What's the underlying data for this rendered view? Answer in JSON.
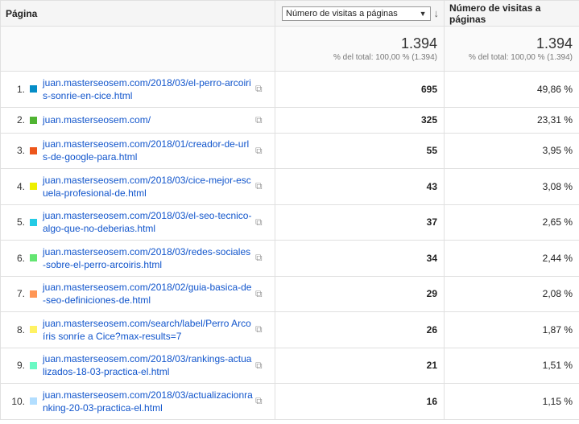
{
  "header": {
    "col_page": "Página",
    "metric_select": "Número de visitas a páginas",
    "col_pct": "Número de visitas a páginas"
  },
  "totals": {
    "value": "1.394",
    "sub": "% del total: 100,00 % (1.394)",
    "value2": "1.394",
    "sub2": "% del total: 100,00 % (1.394)"
  },
  "colors": [
    "#058dc7",
    "#50b432",
    "#ed561b",
    "#edef00",
    "#24cbe5",
    "#64e572",
    "#ff9655",
    "#fff263",
    "#6af9c4",
    "#b2deff"
  ],
  "rows": [
    {
      "num": "1.",
      "page": "juan.masterseosem.com/2018/03/el-perro-arcoiris-sonrie-en-cice.html",
      "visits": "695",
      "pct": "49,86 %"
    },
    {
      "num": "2.",
      "page": "juan.masterseosem.com/",
      "visits": "325",
      "pct": "23,31 %"
    },
    {
      "num": "3.",
      "page": "juan.masterseosem.com/2018/01/creador-de-urls-de-google-para.html",
      "visits": "55",
      "pct": "3,95 %"
    },
    {
      "num": "4.",
      "page": "juan.masterseosem.com/2018/03/cice-mejor-escuela-profesional-de.html",
      "visits": "43",
      "pct": "3,08 %"
    },
    {
      "num": "5.",
      "page": "juan.masterseosem.com/2018/03/el-seo-tecnico-algo-que-no-deberias.html",
      "visits": "37",
      "pct": "2,65 %"
    },
    {
      "num": "6.",
      "page": "juan.masterseosem.com/2018/03/redes-sociales-sobre-el-perro-arcoiris.html",
      "visits": "34",
      "pct": "2,44 %"
    },
    {
      "num": "7.",
      "page": "juan.masterseosem.com/2018/02/guia-basica-de-seo-definiciones-de.html",
      "visits": "29",
      "pct": "2,08 %"
    },
    {
      "num": "8.",
      "page": "juan.masterseosem.com/search/label/Perro Arcoíris sonríe a Cice?max-results=7",
      "visits": "26",
      "pct": "1,87 %"
    },
    {
      "num": "9.",
      "page": "juan.masterseosem.com/2018/03/rankings-actualizados-18-03-practica-el.html",
      "visits": "21",
      "pct": "1,51 %"
    },
    {
      "num": "10.",
      "page": "juan.masterseosem.com/2018/03/actualizacionranking-20-03-practica-el.html",
      "visits": "16",
      "pct": "1,15 %"
    }
  ]
}
